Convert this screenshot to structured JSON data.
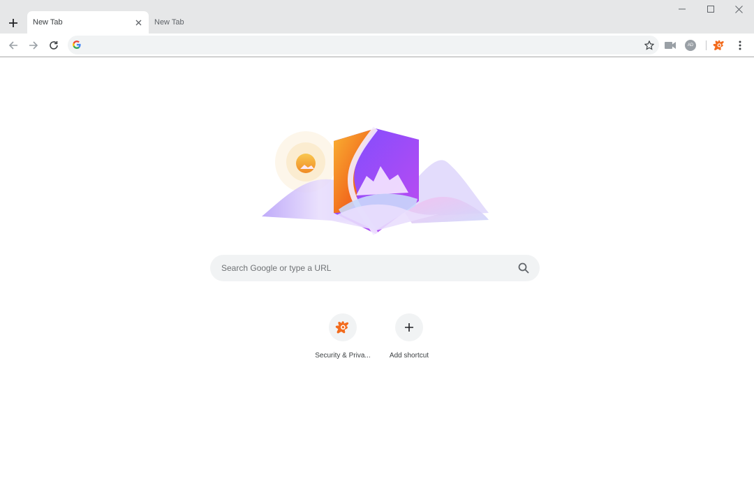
{
  "tabs": [
    {
      "title": "New Tab",
      "active": true
    },
    {
      "title": "New Tab",
      "active": false
    }
  ],
  "omnibox": {
    "value": "",
    "placeholder": ""
  },
  "toolbar": {
    "icons": [
      "back-icon",
      "forward-icon",
      "reload-icon",
      "google-icon",
      "bookmark-star-icon",
      "video-icon",
      "profile-avatar-icon",
      "avast-extension-icon",
      "more-menu-icon"
    ],
    "avatar_initials": "AD"
  },
  "window_controls": [
    "minimize-icon",
    "maximize-icon",
    "close-icon"
  ],
  "search": {
    "placeholder": "Search Google or type a URL"
  },
  "shortcuts": [
    {
      "label": "Security & Priva...",
      "icon": "avast-icon"
    },
    {
      "label": "Add shortcut",
      "icon": "plus-icon"
    }
  ],
  "colors": {
    "accent_orange": "#f26b1d",
    "titlebar": "#e6e7e8",
    "omnibox_bg": "#f1f3f4"
  }
}
